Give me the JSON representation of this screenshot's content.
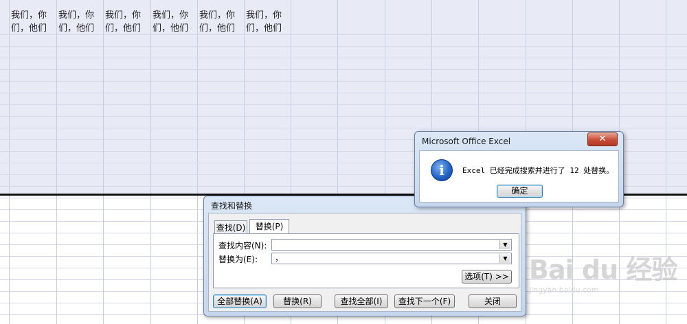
{
  "sheet": {
    "cells": [
      "我们，你\n们，他们",
      "我们，你\n们，他们",
      "我们，你\n们，他们",
      "我们，你\n们，他们",
      "我们，你\n们，他们",
      "我们，你\n们，他们"
    ]
  },
  "message_box": {
    "title": "Microsoft Office Excel",
    "close_glyph": "✕",
    "icon_glyph": "i",
    "message": "Excel 已经完成搜索并进行了 12 处替换。",
    "ok_label": "确定"
  },
  "find_replace": {
    "title": "查找和替换",
    "tabs": [
      {
        "label": "查找(D)",
        "active": false
      },
      {
        "label": "替换(P)",
        "active": true
      }
    ],
    "find_label": "查找内容(N):",
    "find_value": "",
    "replace_label": "替换为(E):",
    "replace_value": "，",
    "options_label": "选项(T) >>",
    "buttons": {
      "replace_all": "全部替换(A)",
      "replace": "替换(R)",
      "find_all": "查找全部(I)",
      "find_next": "查找下一个(F)",
      "close": "关闭"
    },
    "dropdown_glyph": "▼"
  },
  "watermark": {
    "brand": "Bai du 经验",
    "url": "jingyan.baidu.com"
  }
}
